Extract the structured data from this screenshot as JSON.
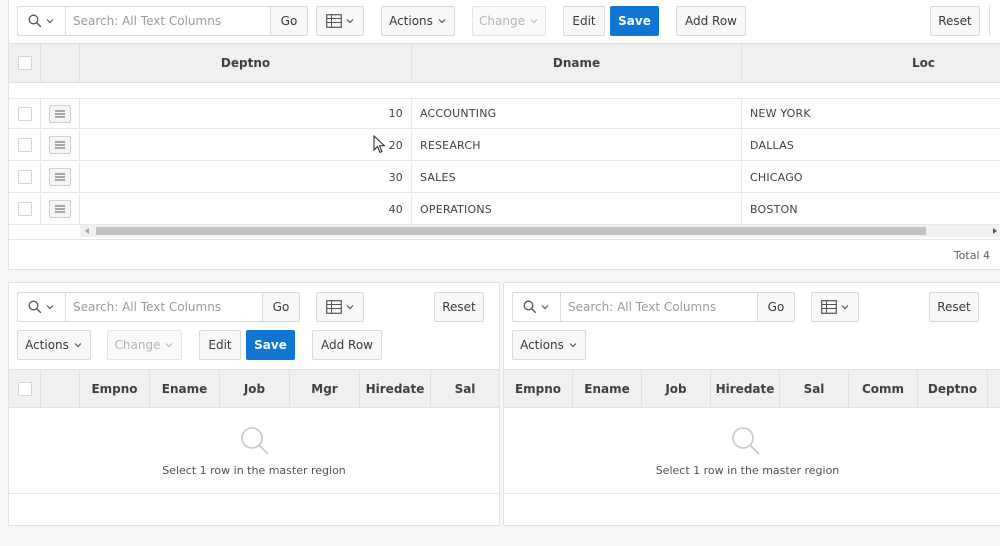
{
  "master": {
    "search_placeholder": "Search: All Text Columns",
    "go_label": "Go",
    "actions_label": "Actions",
    "change_label": "Change",
    "edit_label": "Edit",
    "save_label": "Save",
    "add_row_label": "Add Row",
    "reset_label": "Reset",
    "columns": [
      "Deptno",
      "Dname",
      "Loc"
    ],
    "rows": [
      {
        "deptno": "10",
        "dname": "ACCOUNTING",
        "loc": "NEW YORK"
      },
      {
        "deptno": "20",
        "dname": "RESEARCH",
        "loc": "DALLAS"
      },
      {
        "deptno": "30",
        "dname": "SALES",
        "loc": "CHICAGO"
      },
      {
        "deptno": "40",
        "dname": "OPERATIONS",
        "loc": "BOSTON"
      }
    ],
    "total_label": "Total 4"
  },
  "detail_emp": {
    "search_placeholder": "Search: All Text Columns",
    "go_label": "Go",
    "actions_label": "Actions",
    "change_label": "Change",
    "edit_label": "Edit",
    "save_label": "Save",
    "add_row_label": "Add Row",
    "reset_label": "Reset",
    "columns": [
      "Empno",
      "Ename",
      "Job",
      "Mgr",
      "Hiredate",
      "Sal"
    ],
    "empty_message": "Select 1 row in the master region"
  },
  "detail_emp_readonly": {
    "search_placeholder": "Search: All Text Columns",
    "go_label": "Go",
    "actions_label": "Actions",
    "reset_label": "Reset",
    "columns": [
      "Empno",
      "Ename",
      "Job",
      "Hiredate",
      "Sal",
      "Comm",
      "Deptno"
    ],
    "empty_message": "Select 1 row in the master region"
  },
  "icons": {
    "search": "search-icon",
    "grid_view": "grid-view-icon",
    "chevron": "chevron-down-icon",
    "row_menu": "row-actions-icon",
    "empty_search": "empty-search-icon",
    "cursor": "mouse-pointer-icon"
  },
  "colors": {
    "primary_button": "#0f76d6",
    "header_bg": "#f0f0f0",
    "page_bg": "#f7f7f7"
  }
}
